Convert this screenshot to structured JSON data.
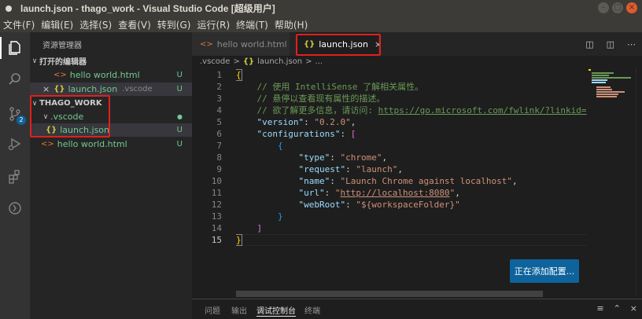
{
  "window": {
    "title": "launch.json - thago_work - Visual Studio Code [超级用户]",
    "buttons": [
      "–",
      "□",
      "×"
    ]
  },
  "menu": [
    "文件(F)",
    "编辑(E)",
    "选择(S)",
    "查看(V)",
    "转到(G)",
    "运行(R)",
    "终端(T)",
    "帮助(H)"
  ],
  "activity": {
    "items": [
      "explorer-icon",
      "search-icon",
      "source-control-icon",
      "run-debug-icon",
      "extensions-icon",
      "remote-icon"
    ],
    "scm_badge": "2"
  },
  "sidebar": {
    "title": "资源管理器",
    "open_editors": {
      "header": "打开的编辑器",
      "items": [
        {
          "name": "hello world.html",
          "icon": "<>",
          "git": "U"
        },
        {
          "name": "launch.json",
          "icon": "{}",
          "path": ".vscode",
          "git": "U",
          "close": "×"
        }
      ]
    },
    "workspace": {
      "header": "THAGO_WORK",
      "folder": {
        "name": ".vscode",
        "git": "●"
      },
      "items": [
        {
          "name": "launch.json",
          "icon": "{}",
          "git": "U"
        },
        {
          "name": "hello world.html",
          "icon": "<>",
          "git": "U"
        }
      ]
    }
  },
  "tabs": [
    {
      "label": "hello world.html",
      "icon": "<>"
    },
    {
      "label": "launch.json",
      "icon": "{}",
      "close": "×"
    }
  ],
  "breadcrumb": [
    ".vscode",
    ">",
    "{}",
    "launch.json",
    ">",
    "..."
  ],
  "code": {
    "line_numbers": [
      "1",
      "2",
      "3",
      "4",
      "5",
      "6",
      "7",
      "8",
      "9",
      "10",
      "11",
      "12",
      "13",
      "14",
      "15"
    ],
    "current_line": "15",
    "lines": {
      "l2": "// 使用 IntelliSense 了解相关属性。",
      "l3": "// 悬停以查看现有属性的描述。",
      "l4_prefix": "// 欲了解更多信息，请访问: ",
      "l4_link": "https://go.microsoft.com/fwlink/?linkid=",
      "version_key": "\"version\"",
      "version_val": "\"0.2.0\"",
      "configs_key": "\"configurations\"",
      "type_key": "\"type\"",
      "type_val": "\"chrome\"",
      "request_key": "\"request\"",
      "request_val": "\"launch\"",
      "name_key": "\"name\"",
      "name_val": "\"Launch Chrome against localhost\"",
      "url_key": "\"url\"",
      "url_val": "http://localhost:8080",
      "webroot_key": "\"webRoot\"",
      "webroot_val": "\"${workspaceFolder}\""
    }
  },
  "notification": "正在添加配置...",
  "panel": {
    "tabs": [
      "问题",
      "输出",
      "调试控制台",
      "终端"
    ],
    "active_tab": "调试控制台"
  },
  "colors": {
    "highlight_box": "#e0201c",
    "accent_blue": "#0e639c"
  }
}
